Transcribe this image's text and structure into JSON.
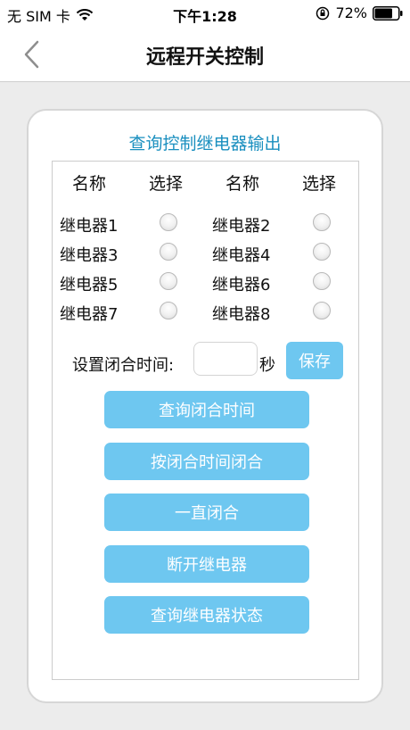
{
  "status_bar": {
    "carrier": "无 SIM 卡",
    "time": "下午1:28",
    "battery": "72%"
  },
  "nav": {
    "title": "远程开关控制"
  },
  "card": {
    "title": "查询控制继电器输出",
    "headers": {
      "name_1": "名称",
      "select_1": "选择",
      "name_2": "名称",
      "select_2": "选择"
    },
    "relays": [
      {
        "label": "继电器1",
        "selected": false
      },
      {
        "label": "继电器2",
        "selected": false
      },
      {
        "label": "继电器3",
        "selected": false
      },
      {
        "label": "继电器4",
        "selected": false
      },
      {
        "label": "继电器5",
        "selected": false
      },
      {
        "label": "继电器6",
        "selected": false
      },
      {
        "label": "继电器7",
        "selected": false
      },
      {
        "label": "继电器8",
        "selected": false
      }
    ],
    "close_time": {
      "label": "设置闭合时间:",
      "value": "",
      "unit": "秒",
      "save_label": "保存"
    },
    "buttons": {
      "query_close_time": "查询闭合时间",
      "close_by_time": "按闭合时间闭合",
      "always_close": "一直闭合",
      "disconnect": "断开继电器",
      "query_status": "查询继电器状态"
    }
  },
  "colors": {
    "accent": "#6ec7f0",
    "title_blue": "#1a8fbf",
    "background": "#ececec"
  }
}
